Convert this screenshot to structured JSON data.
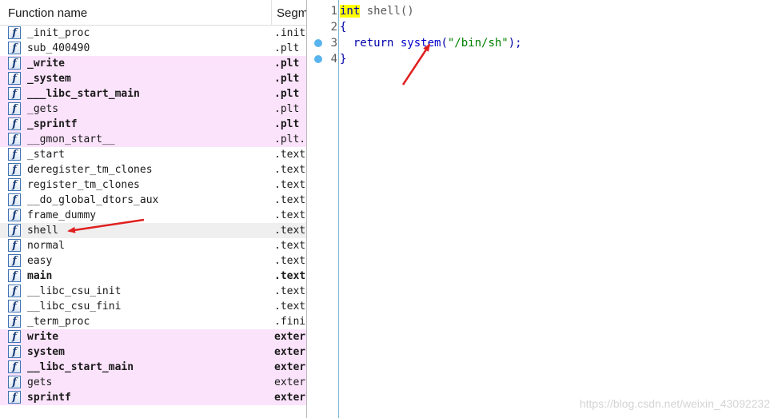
{
  "functions_window": {
    "header": {
      "name_col": "Function name",
      "segment_col": "Segm"
    },
    "icon": "f",
    "rows": [
      {
        "name": "_init_proc",
        "segment": ".init",
        "style": "normal"
      },
      {
        "name": "sub_400490",
        "segment": ".plt",
        "style": "normal"
      },
      {
        "name": "_write",
        "segment": ".plt",
        "style": "pink-bold"
      },
      {
        "name": "_system",
        "segment": ".plt",
        "style": "pink-bold"
      },
      {
        "name": "___libc_start_main",
        "segment": ".plt",
        "style": "pink-bold"
      },
      {
        "name": "_gets",
        "segment": ".plt",
        "style": "pink"
      },
      {
        "name": "_sprintf",
        "segment": ".plt",
        "style": "pink-bold"
      },
      {
        "name": "__gmon_start__",
        "segment": ".plt.",
        "style": "pink"
      },
      {
        "name": "_start",
        "segment": ".text",
        "style": "normal"
      },
      {
        "name": "deregister_tm_clones",
        "segment": ".text",
        "style": "normal"
      },
      {
        "name": "register_tm_clones",
        "segment": ".text",
        "style": "normal"
      },
      {
        "name": "__do_global_dtors_aux",
        "segment": ".text",
        "style": "normal"
      },
      {
        "name": "frame_dummy",
        "segment": ".text",
        "style": "normal"
      },
      {
        "name": "shell",
        "segment": ".text",
        "style": "selected"
      },
      {
        "name": "normal",
        "segment": ".text",
        "style": "normal"
      },
      {
        "name": "easy",
        "segment": ".text",
        "style": "normal"
      },
      {
        "name": "main",
        "segment": ".text",
        "style": "bold"
      },
      {
        "name": "__libc_csu_init",
        "segment": ".text",
        "style": "normal"
      },
      {
        "name": "__libc_csu_fini",
        "segment": ".text",
        "style": "normal"
      },
      {
        "name": "_term_proc",
        "segment": ".fini",
        "style": "normal"
      },
      {
        "name": "write",
        "segment": "exter",
        "style": "pink-bold"
      },
      {
        "name": "system",
        "segment": "exter",
        "style": "pink-bold"
      },
      {
        "name": "__libc_start_main",
        "segment": "exter",
        "style": "pink-bold"
      },
      {
        "name": "gets",
        "segment": "exter",
        "style": "pink"
      },
      {
        "name": "sprintf",
        "segment": "exter",
        "style": "pink-bold"
      }
    ]
  },
  "pseudocode": {
    "lines": [
      {
        "num": "1",
        "breakpoint": false,
        "tokens": [
          {
            "t": "int",
            "c": "kw-hl"
          },
          {
            "t": " shell()",
            "c": "tok-fn"
          }
        ]
      },
      {
        "num": "2",
        "breakpoint": false,
        "tokens": [
          {
            "t": "{",
            "c": "tok-kw"
          }
        ]
      },
      {
        "num": "3",
        "breakpoint": true,
        "tokens": [
          {
            "t": "  return ",
            "c": "tok-kw"
          },
          {
            "t": "system",
            "c": "tok-call"
          },
          {
            "t": "(",
            "c": "tok-kw"
          },
          {
            "t": "\"/bin/sh\"",
            "c": "tok-str"
          },
          {
            "t": ");",
            "c": "tok-kw"
          }
        ]
      },
      {
        "num": "4",
        "breakpoint": true,
        "tokens": [
          {
            "t": "}",
            "c": "tok-kw"
          }
        ]
      }
    ]
  },
  "annotations": {
    "arrow_color": "#e02020"
  },
  "watermark": "https://blog.csdn.net/weixin_43092232"
}
